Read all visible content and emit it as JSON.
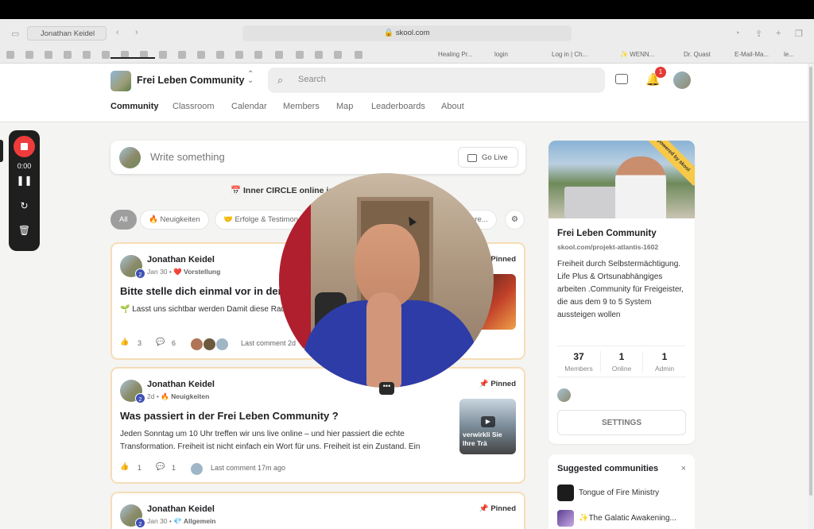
{
  "browser": {
    "tab_title": "Jonathan Keidel",
    "url": "skool.com",
    "bookmarks": [
      "Healing Pr...",
      "login",
      "Log in | Ch...",
      "✨ WENN...",
      "Dr. Quast",
      "E-Mail-Ma...",
      "le..."
    ]
  },
  "header": {
    "community_name": "Frei Leben Community",
    "search_placeholder": "Search",
    "notification_count": "1",
    "nav_tabs": [
      "Community",
      "Classroom",
      "Calendar",
      "Members",
      "Map",
      "Leaderboards",
      "About"
    ]
  },
  "recorder": {
    "time": "0:00"
  },
  "composer": {
    "placeholder": "Write something",
    "go_live": "Go Live"
  },
  "event_banner": "Inner CIRCLE online is",
  "filters": [
    "All",
    "🔥 Neuigkeiten",
    "🤝 Erfolge & Testimon",
    "ore..."
  ],
  "posts": [
    {
      "author": "Jonathan Keidel",
      "level": "2",
      "date": "Jan 30",
      "category": "❤️ Vorstellung",
      "pinned": "Pinned",
      "title": "Bitte stelle dich einmal vor in der",
      "body": "🌱 Lasst uns sichtbar werden Damit diese Raum wird, braucht es nicht nur Inhalte – so",
      "likes": "3",
      "comments": "6",
      "last_comment": "Last comment 2d"
    },
    {
      "author": "Jonathan Keidel",
      "level": "2",
      "date": "2d",
      "category": "🔥 Neuigkeiten",
      "pinned": "Pinned",
      "title": "Was passiert in der Frei Leben Community ?",
      "body": "Jeden Sonntag um 10 Uhr treffen wir uns live online – und hier passiert die echte Transformation. Freiheit ist nicht einfach ein Wort für uns. Freiheit ist ein Zustand. Ein",
      "likes": "1",
      "comments": "1",
      "last_comment": "Last comment 17m ago",
      "thumb_text": "verwirkli Sie Ihre Trä"
    },
    {
      "author": "Jonathan Keidel",
      "level": "2",
      "date": "Jan 30",
      "category": "💎 Allgemein",
      "pinned": "Pinned"
    }
  ],
  "about": {
    "ribbon": "powered by skool",
    "name": "Frei Leben Community",
    "url": "skool.com/projekt-atlantis-1602",
    "description": "Freiheit durch Selbstermächtigung. Life Plus & Ortsunabhängiges arbeiten .Community für Freigeister, die aus dem 9 to 5 System aussteigen wollen",
    "stats": [
      {
        "value": "37",
        "label": "Members"
      },
      {
        "value": "1",
        "label": "Online"
      },
      {
        "value": "1",
        "label": "Admin"
      }
    ],
    "settings": "SETTINGS"
  },
  "suggested": {
    "title": "Suggested communities",
    "close": "×",
    "items": [
      "Tongue of Fire Ministry",
      "✨The Galatic Awakening..."
    ]
  },
  "colors": {
    "accent": "#202124",
    "pinned_border": "#f6ddb6",
    "record": "#ef3b3b",
    "badge": "#e53935"
  }
}
